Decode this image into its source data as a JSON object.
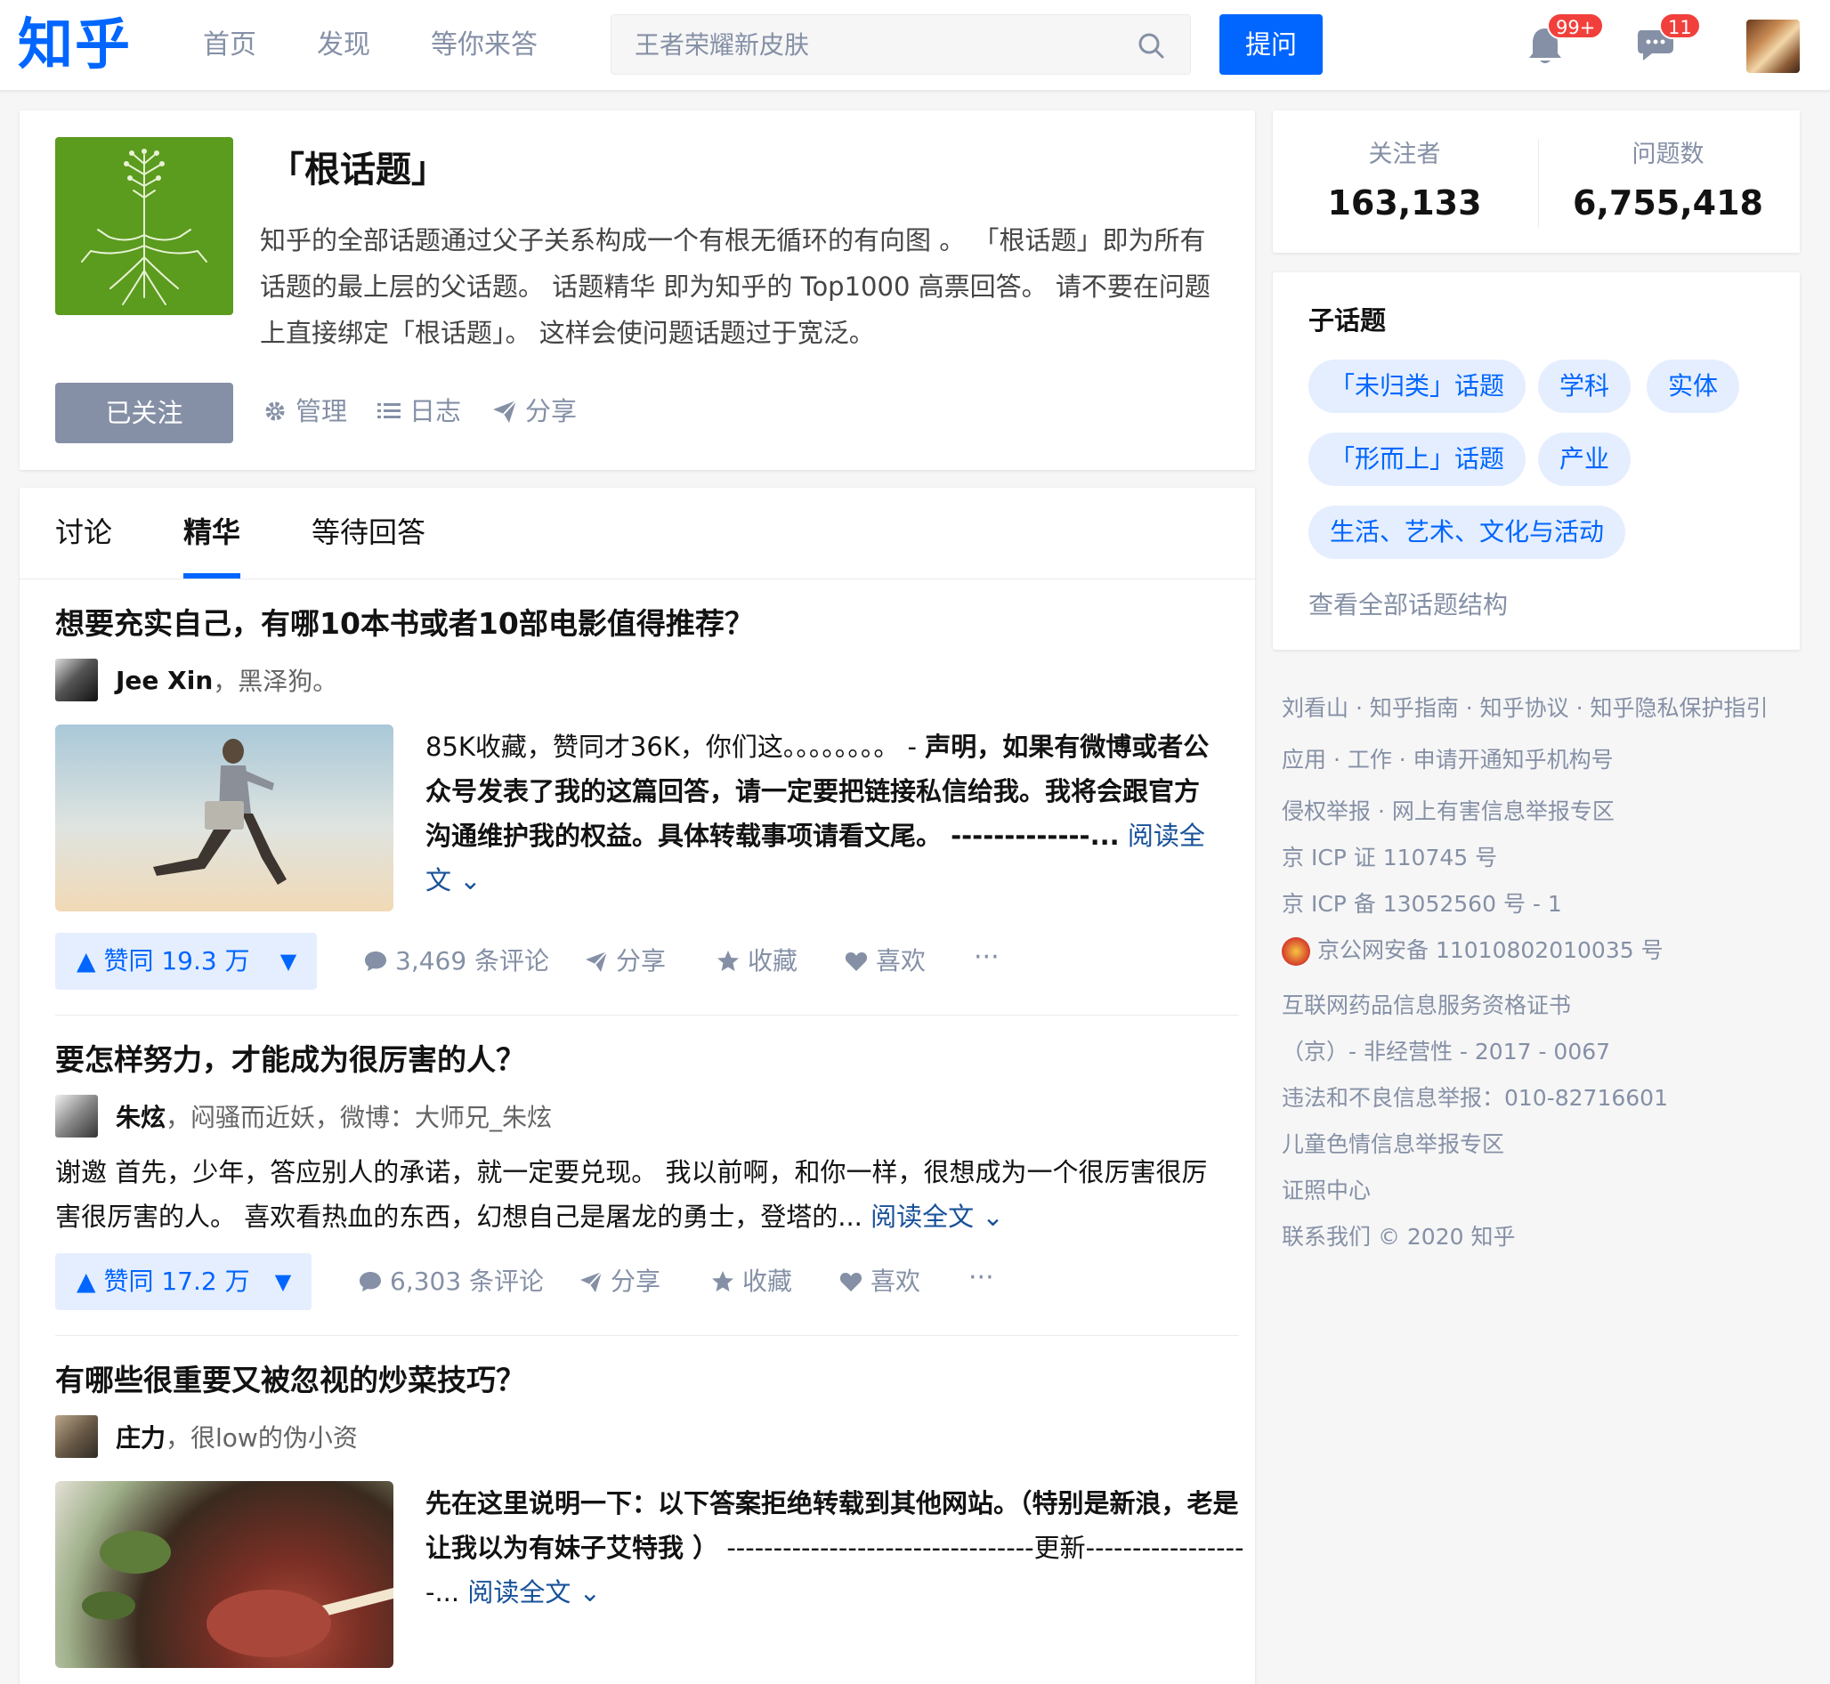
{
  "header": {
    "logo": "知乎",
    "nav": [
      "首页",
      "发现",
      "等你来答"
    ],
    "search_placeholder": "王者荣耀新皮肤",
    "ask_label": "提问",
    "notif_badge": "99+",
    "msg_badge": "11"
  },
  "topic": {
    "title": "「根话题」",
    "desc": "知乎的全部话题通过父子关系构成一个有根无循环的有向图 。 「根话题」即为所有话题的最上层的父话题。 话题精华 即为知乎的 Top1000 高票回答。 请不要在问题上直接绑定「根话题」。 这样会使问题话题过于宽泛。",
    "follow_label": "已关注",
    "tools": [
      "管理",
      "日志",
      "分享"
    ]
  },
  "tabs": [
    "讨论",
    "精华",
    "等待回答"
  ],
  "feed": [
    {
      "question": "想要充实自己，有哪10本书或者10部电影值得推荐？",
      "author": "Jee Xin",
      "bio": "，黑泽狗。",
      "excerpt_plain": "85K收藏，赞同才36K，你们这。。。。。。。。 - ",
      "excerpt_bold": "声明，如果有微博或者公众号发表了我的这篇回答，请一定要把链接私信给我。我将会跟官方沟通维护我的权益。具体转载事项请看文尾。 -------------...",
      "read_more": "阅读全文",
      "votes": "赞同 19.3 万",
      "comments": "3,469 条评论",
      "share": "分享",
      "collect": "收藏",
      "like": "喜欢"
    },
    {
      "question": "要怎样努力，才能成为很厉害的人？",
      "author": "朱炫",
      "bio": "，闷骚而近妖，微博：大师兄_朱炫",
      "excerpt": "谢邀 首先，少年，答应别人的承诺，就一定要兑现。 我以前啊，和你一样，很想成为一个很厉害很厉害很厉害的人。 喜欢看热血的东西，幻想自己是屠龙的勇士，登塔的...",
      "read_more": "阅读全文",
      "votes": "赞同 17.2 万",
      "comments": "6,303 条评论",
      "share": "分享",
      "collect": "收藏",
      "like": "喜欢"
    },
    {
      "question": "有哪些很重要又被忽视的炒菜技巧？",
      "author": "庄力",
      "bio": "，很low的伪小资",
      "excerpt_bold": "先在这里说明一下：以下答案拒绝转载到其他网站。（特别是新浪，老是让我以为有妹子艾特我 ）",
      "excerpt_plain": " ---------------------------------更新------------------...",
      "read_more": "阅读全文"
    }
  ],
  "sidebar": {
    "followers_label": "关注者",
    "followers": "163,133",
    "questions_label": "问题数",
    "questions": "6,755,418",
    "sub_title": "子话题",
    "chips": [
      "「未归类」话题",
      "学科",
      "实体",
      "「形而上」话题",
      "产业",
      "生活、艺术、文化与活动"
    ],
    "see_all": "查看全部话题结构",
    "footer": [
      "刘看山 · 知乎指南 · 知乎协议 · 知乎隐私保护指引",
      "应用 · 工作 · 申请开通知乎机构号",
      "侵权举报 · 网上有害信息举报专区",
      "京 ICP 证 110745 号",
      "京 ICP 备 13052560 号 - 1",
      "京公网安备 11010802010035 号",
      "互联网药品信息服务资格证书",
      "（京）- 非经营性 - 2017 - 0067",
      "违法和不良信息举报：010-82716601",
      "儿童色情信息举报专区",
      "证照中心",
      "联系我们 © 2020 知乎"
    ]
  },
  "colors": {
    "brand": "#0066ff",
    "muted": "#8590a6",
    "link": "#175199",
    "badge": "#f1403c"
  }
}
